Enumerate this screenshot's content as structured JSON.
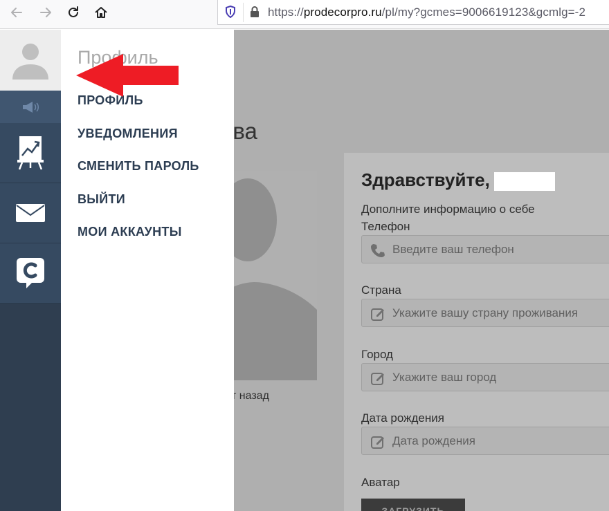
{
  "browser": {
    "url_prefix": "https://",
    "url_domain": "prodecorpro.ru",
    "url_path": "/pl/my?gcmes=9006619123&gcmlg=-2",
    "back_icon": "arrow-left-icon",
    "forward_icon": "arrow-right-icon",
    "reload_icon": "reload-icon",
    "home_icon": "home-icon"
  },
  "rail": {
    "items": [
      {
        "icon": "user-avatar-icon"
      },
      {
        "icon": "megaphone-icon"
      },
      {
        "icon": "chart-board-icon"
      },
      {
        "icon": "mail-icon"
      },
      {
        "icon": "chat-c-icon"
      }
    ]
  },
  "menu": {
    "title": "Профиль",
    "items": [
      {
        "label": "ПРОФИЛЬ"
      },
      {
        "label": "УВЕДОМЛЕНИЯ"
      },
      {
        "label": "СМЕНИТЬ ПАРОЛЬ"
      },
      {
        "label": "ВЫЙТИ"
      },
      {
        "label": "МОИ АККАУНТЫ"
      }
    ]
  },
  "page": {
    "name_fragment": "ова",
    "ago_fragment": "ут назад"
  },
  "form": {
    "greeting": "Здравствуйте,",
    "subtitle": "Дополните информацию о себе",
    "phone_label": "Телефон",
    "phone_placeholder": "Введите ваш телефон",
    "country_label": "Страна",
    "country_placeholder": "Укажите вашу страну проживания",
    "city_label": "Город",
    "city_placeholder": "Укажите ваш город",
    "birth_label": "Дата рождения",
    "birth_placeholder": "Дата рождения",
    "avatar_label": "Аватар",
    "upload_label": "ЗАГРУЗИТЬ"
  },
  "colors": {
    "rail": "#2f3e50",
    "menu_text": "#2c3d52",
    "arrow": "#ee1c25",
    "overlay": "#afafaf"
  }
}
